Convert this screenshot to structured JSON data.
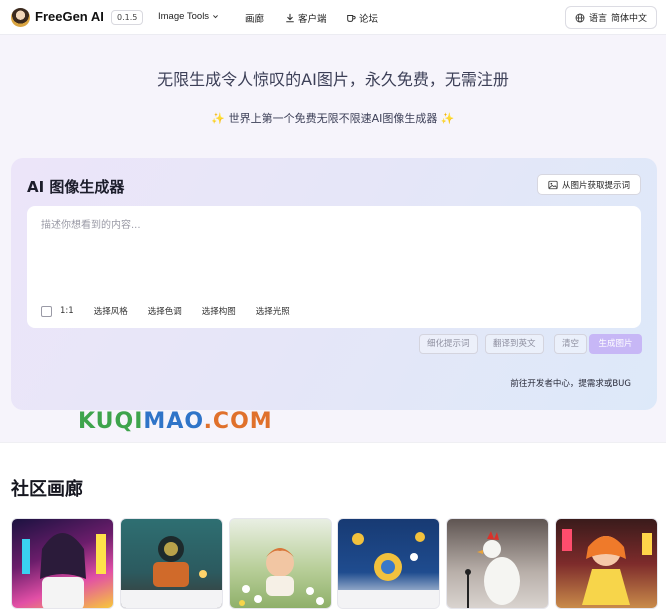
{
  "nav": {
    "brand": "FreeGen AI",
    "version": "0.1.5",
    "links": [
      {
        "label": "Image Tools",
        "icon": "chevron-down-icon"
      },
      {
        "label": "画廊"
      },
      {
        "label": "客户端",
        "icon": "download-icon"
      },
      {
        "label": "论坛",
        "icon": "cup-icon"
      }
    ],
    "lang_label": "语言",
    "lang_value": "简体中文"
  },
  "hero": {
    "title": "无限生成令人惊叹的AI图片，永久免费，无需注册",
    "subtitle": "世界上第一个免费无限不限速AI图像生成器",
    "sparkle": "✨"
  },
  "generator": {
    "title": "AI 图像生成器",
    "from_image_label": "从图片获取提示词",
    "prompt": {
      "value": "",
      "placeholder": "描述你想看到的内容..."
    },
    "ratio": "1:1",
    "options": [
      "选择风格",
      "选择色调",
      "选择构图",
      "选择光照"
    ],
    "actions": [
      "细化提示词",
      "翻译到英文",
      "清空"
    ],
    "generate_label": "生成图片",
    "dev_link": "前往开发者中心，提需求或BUG"
  },
  "watermark": {
    "part1": "KUQI",
    "part2": "MAO",
    "part3": ".COM"
  },
  "gallery": {
    "title": "社区画廊",
    "items": [
      {
        "name": "gallery-item-1"
      },
      {
        "name": "gallery-item-2"
      },
      {
        "name": "gallery-item-3"
      },
      {
        "name": "gallery-item-4"
      },
      {
        "name": "gallery-item-5"
      },
      {
        "name": "gallery-item-6"
      }
    ]
  },
  "colors": {
    "accent": "#c7b7f6",
    "card_bg_start": "#ece5f9",
    "card_bg_end": "#dde9f9"
  }
}
